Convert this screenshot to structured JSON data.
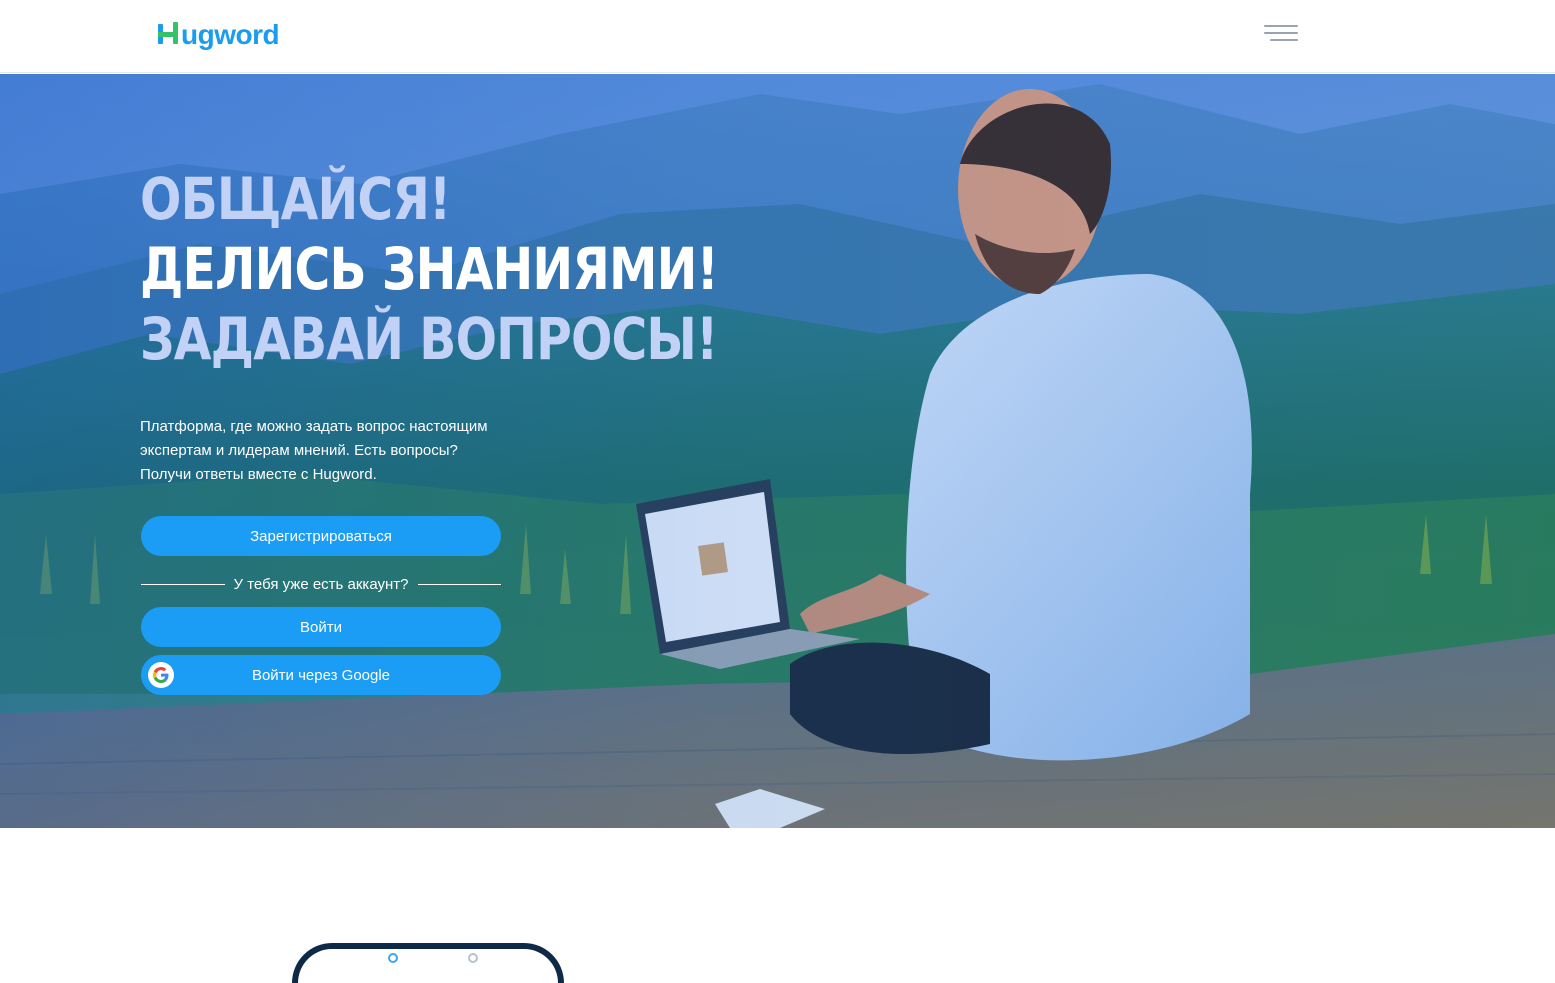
{
  "header": {
    "logo_text": "ugword",
    "logo_icon": "hugword-h-logo-icon",
    "menu_icon": "hamburger-menu-icon"
  },
  "hero": {
    "headline_line1": "ОБЩАЙСЯ!",
    "headline_line2": "ДЕЛИСЬ ЗНАНИЯМИ!",
    "headline_line3": "ЗАДАВАЙ ВОПРОСЫ!",
    "description_line1": "Платформа, где можно задать вопрос настоящим",
    "description_line2": "экспертам и лидерам мнений. Есть вопросы?",
    "description_line3": "Получи ответы вместе с Hugword.",
    "register_label": "Зарегистрироваться",
    "have_account_text": "У тебя уже есть аккаунт?",
    "login_label": "Войти",
    "google_login_label": "Войти через Google",
    "google_icon": "google-g-icon"
  },
  "colors": {
    "brand_blue": "#1b9cf0",
    "brand_green": "#36c26b",
    "button_blue": "#1b9cf5",
    "headline_pale": "#c2d2f7",
    "phone_frame": "#0f2a48"
  }
}
